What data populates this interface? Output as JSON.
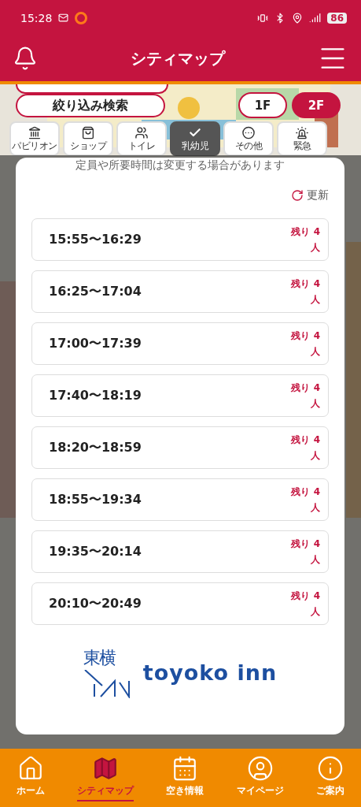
{
  "status_bar": {
    "time": "15:28",
    "battery": "86"
  },
  "header": {
    "title": "シティマップ"
  },
  "map_controls": {
    "filter_button": "絞り込み検索",
    "categories": [
      {
        "label": "パビリオン",
        "selected": false
      },
      {
        "label": "ショップ",
        "selected": false
      },
      {
        "label": "トイレ",
        "selected": false
      },
      {
        "label": "乳幼児",
        "selected": true
      },
      {
        "label": "その他",
        "selected": false
      },
      {
        "label": "緊急",
        "selected": false
      }
    ],
    "floors": [
      {
        "label": "1F",
        "selected": false
      },
      {
        "label": "2F",
        "selected": true
      }
    ]
  },
  "modal": {
    "notice": "定員や所要時間は変更する場合があります",
    "refresh": "更新",
    "slots": [
      {
        "time": "15:55〜16:29",
        "remaining": "残り 4",
        "unit": "人"
      },
      {
        "time": "16:25〜17:04",
        "remaining": "残り 4",
        "unit": "人"
      },
      {
        "time": "17:00〜17:39",
        "remaining": "残り 4",
        "unit": "人"
      },
      {
        "time": "17:40〜18:19",
        "remaining": "残り 4",
        "unit": "人"
      },
      {
        "time": "18:20〜18:59",
        "remaining": "残り 4",
        "unit": "人"
      },
      {
        "time": "18:55〜19:34",
        "remaining": "残り 4",
        "unit": "人"
      },
      {
        "time": "19:35〜20:14",
        "remaining": "残り 4",
        "unit": "人"
      },
      {
        "time": "20:10〜20:49",
        "remaining": "残り 4",
        "unit": "人"
      }
    ],
    "logo": {
      "kanji": "東横",
      "name": "toyoko inn"
    }
  },
  "bottom_nav": [
    {
      "label": "ホーム",
      "selected": false
    },
    {
      "label": "シティマップ",
      "selected": true
    },
    {
      "label": "空き情報",
      "selected": false
    },
    {
      "label": "マイページ",
      "selected": false
    },
    {
      "label": "ご案内",
      "selected": false
    }
  ]
}
